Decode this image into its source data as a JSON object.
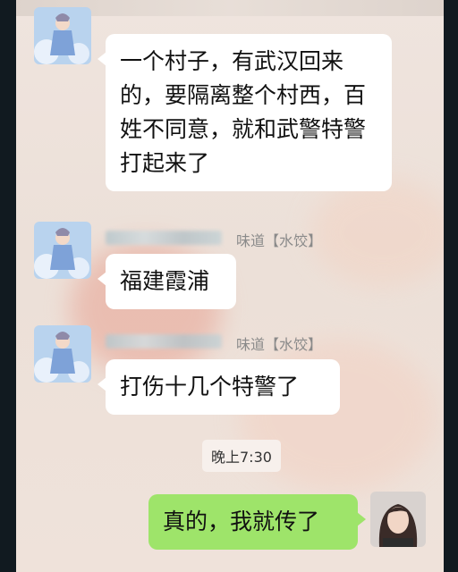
{
  "chat": {
    "messages": [
      {
        "text": "一个村子，有武汉回来的，要隔离整个村西，百姓不同意，就和武警特警打起来了"
      },
      {
        "sender_suffix": "味道【水饺】",
        "text": "福建霞浦"
      },
      {
        "sender_suffix": "味道【水饺】",
        "text": "打伤十几个特警了"
      }
    ],
    "timestamp": "晚上7:30",
    "my_message": "真的，我就传了"
  },
  "colors": {
    "incoming_bubble": "#ffffff",
    "outgoing_bubble": "#9ee46a",
    "background": "#efe4de"
  }
}
